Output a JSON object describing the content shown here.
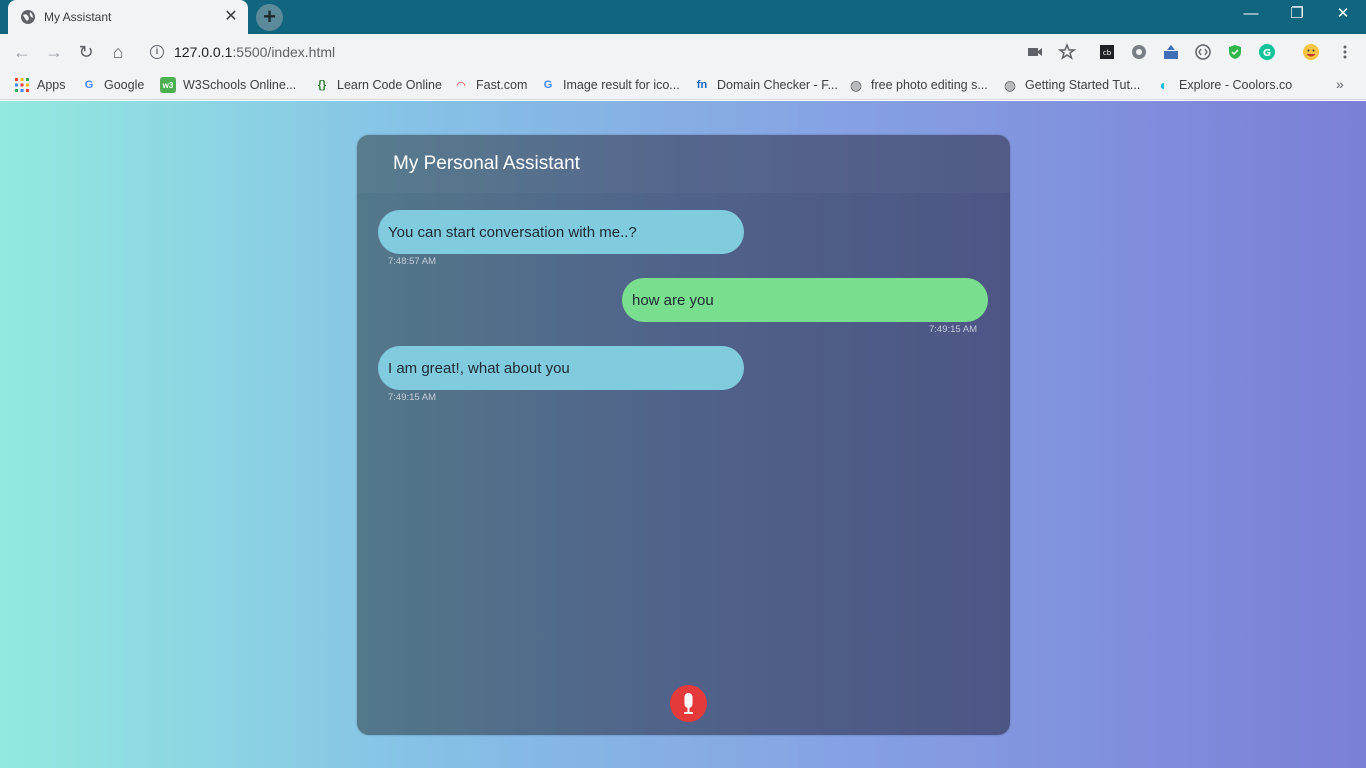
{
  "browser": {
    "tab_title": "My Assistant",
    "tab_close": "✕",
    "new_tab": "+",
    "window_controls": {
      "minimize": "—",
      "restore": "❐",
      "close": "✕"
    },
    "nav": {
      "back": "←",
      "forward": "→",
      "reload": "↻",
      "home": "⌂"
    },
    "url_host": "127.0.0.1",
    "url_path": ":5500/index.html",
    "bookmarks": [
      {
        "label": "Apps",
        "icon": "apps-grid-icon"
      },
      {
        "label": "Google",
        "icon": "google-icon"
      },
      {
        "label": "W3Schools Online...",
        "icon": "w3schools-icon"
      },
      {
        "label": "Learn Code Online",
        "icon": "code-icon"
      },
      {
        "label": "Fast.com",
        "icon": "fast-icon"
      },
      {
        "label": "Image result for ico...",
        "icon": "google-icon"
      },
      {
        "label": "Domain Checker - F...",
        "icon": "fn-icon"
      },
      {
        "label": "free photo editing s...",
        "icon": "globe-icon"
      },
      {
        "label": "Getting Started Tut...",
        "icon": "globe-icon"
      },
      {
        "label": "Explore - Coolors.co",
        "icon": "coolors-icon"
      }
    ],
    "bookmarks_more": "»"
  },
  "assistant": {
    "title": "My Personal Assistant",
    "messages": [
      {
        "from": "bot",
        "text": "You can start conversation with me..?",
        "time": "7:48:57 AM"
      },
      {
        "from": "user",
        "text": "how are you",
        "time": "7:49:15 AM"
      },
      {
        "from": "bot",
        "text": "I am great!, what about you",
        "time": "7:49:15 AM"
      }
    ]
  },
  "colors": {
    "titlebar": "#12657f",
    "bot_bubble": "#80cbde",
    "user_bubble": "#79de8e",
    "mic_button": "#e53a3a"
  }
}
